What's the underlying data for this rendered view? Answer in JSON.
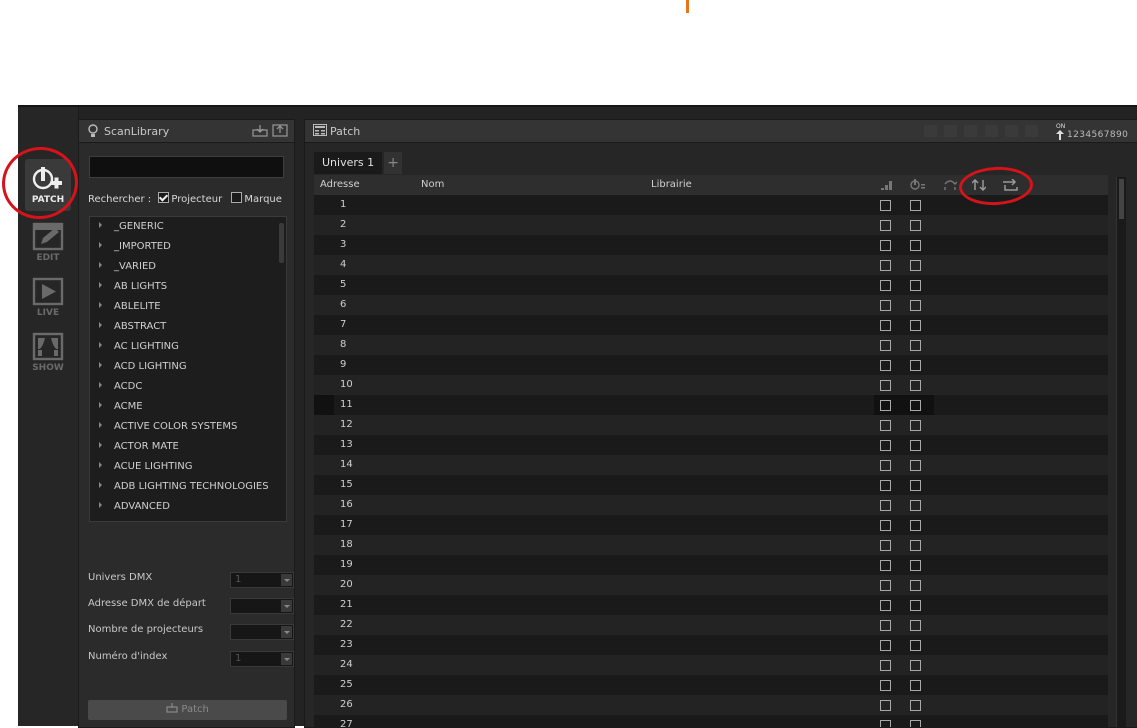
{
  "modes": [
    {
      "key": "patch",
      "label": "PATCH",
      "icon": "patch-plug-icon",
      "active": true
    },
    {
      "key": "edit",
      "label": "EDIT",
      "icon": "edit-pencil-icon",
      "active": false
    },
    {
      "key": "live",
      "label": "LIVE",
      "icon": "live-play-icon",
      "active": false
    },
    {
      "key": "show",
      "label": "SHOW",
      "icon": "show-curtain-icon",
      "active": false
    }
  ],
  "library": {
    "title": "ScanLibrary",
    "search_value": "",
    "search_label": "Rechercher :",
    "filter_projecteur": "Projecteur",
    "filter_marque": "Marque",
    "items": [
      "_GENERIC",
      "_IMPORTED",
      "_VARIED",
      "AB LIGHTS",
      "ABLELITE",
      "ABSTRACT",
      "AC LIGHTING",
      "ACD LIGHTING",
      "ACDC",
      "ACME",
      "ACTIVE COLOR SYSTEMS",
      "ACTOR MATE",
      "ACUE LIGHTING",
      "ADB LIGHTING TECHNOLOGIES",
      "ADVANCED"
    ],
    "fields": {
      "univers_label": "Univers DMX",
      "univers_value": "1",
      "adresse_label": "Adresse DMX de départ",
      "nombre_label": "Nombre de projecteurs",
      "index_label": "Numéro d'index",
      "index_value": "1"
    },
    "patch_button": "Patch"
  },
  "patch": {
    "title": "Patch",
    "tab_label": "Univers 1",
    "tab_add": "+",
    "columns": {
      "adresse": "Adresse",
      "nom": "Nom",
      "librairie": "Librairie"
    },
    "on_label": "ON",
    "channel_digits": "1234567890",
    "rows": [
      "1",
      "2",
      "3",
      "4",
      "5",
      "6",
      "7",
      "8",
      "9",
      "10",
      "11",
      "12",
      "13",
      "14",
      "15",
      "16",
      "17",
      "18",
      "19",
      "20",
      "21",
      "22",
      "23",
      "24",
      "25",
      "26",
      "27"
    ],
    "selected_row": "11"
  },
  "colors": {
    "annotation": "#d4141a",
    "accent": "#e8751a"
  }
}
